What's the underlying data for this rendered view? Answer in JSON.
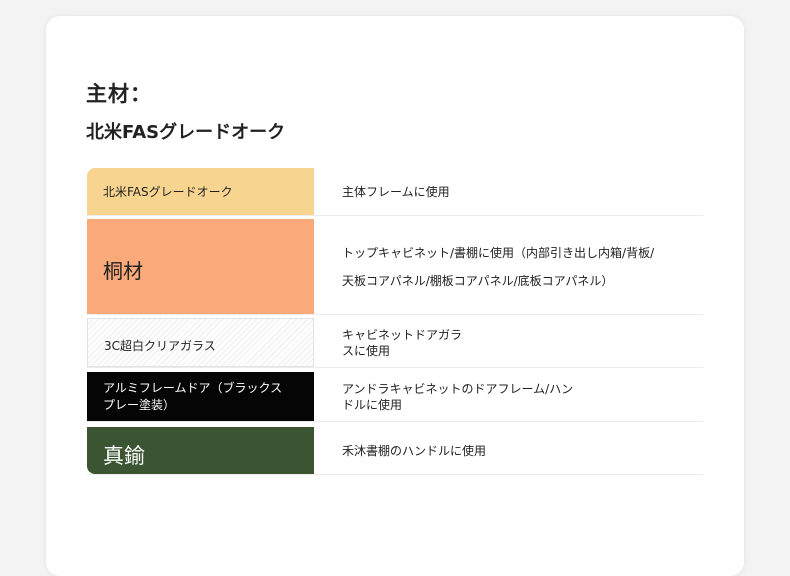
{
  "material": {
    "heading": "主材：",
    "subheading": "北米FASグレードオーク"
  },
  "rows": [
    {
      "name": "北米FASグレードオーク",
      "color": "#f7d48f",
      "usage": [
        "主体フレームに使用"
      ]
    },
    {
      "name": "桐材",
      "color": "#f9a97a",
      "usage": [
        "トップキャビネット/書棚に使用（内部引き出し内箱/背板/",
        "天板コアパネル/棚板コアパネル/底板コアパネル）"
      ]
    },
    {
      "name": "3C超白クリアガラス",
      "color": "#ffffff",
      "usage": [
        "キャビネットドアガラ",
        "スに使用"
      ]
    },
    {
      "name": "アルミフレームドア（ブラックスプレー塗装）",
      "color": "#050505",
      "usage": [
        "アンドラキャビネットのドアフレーム/ハン",
        "ドルに使用"
      ]
    },
    {
      "name": "真鍮",
      "color": "#3b5432",
      "usage": [
        "禾沐書棚のハンドルに使用"
      ]
    }
  ]
}
